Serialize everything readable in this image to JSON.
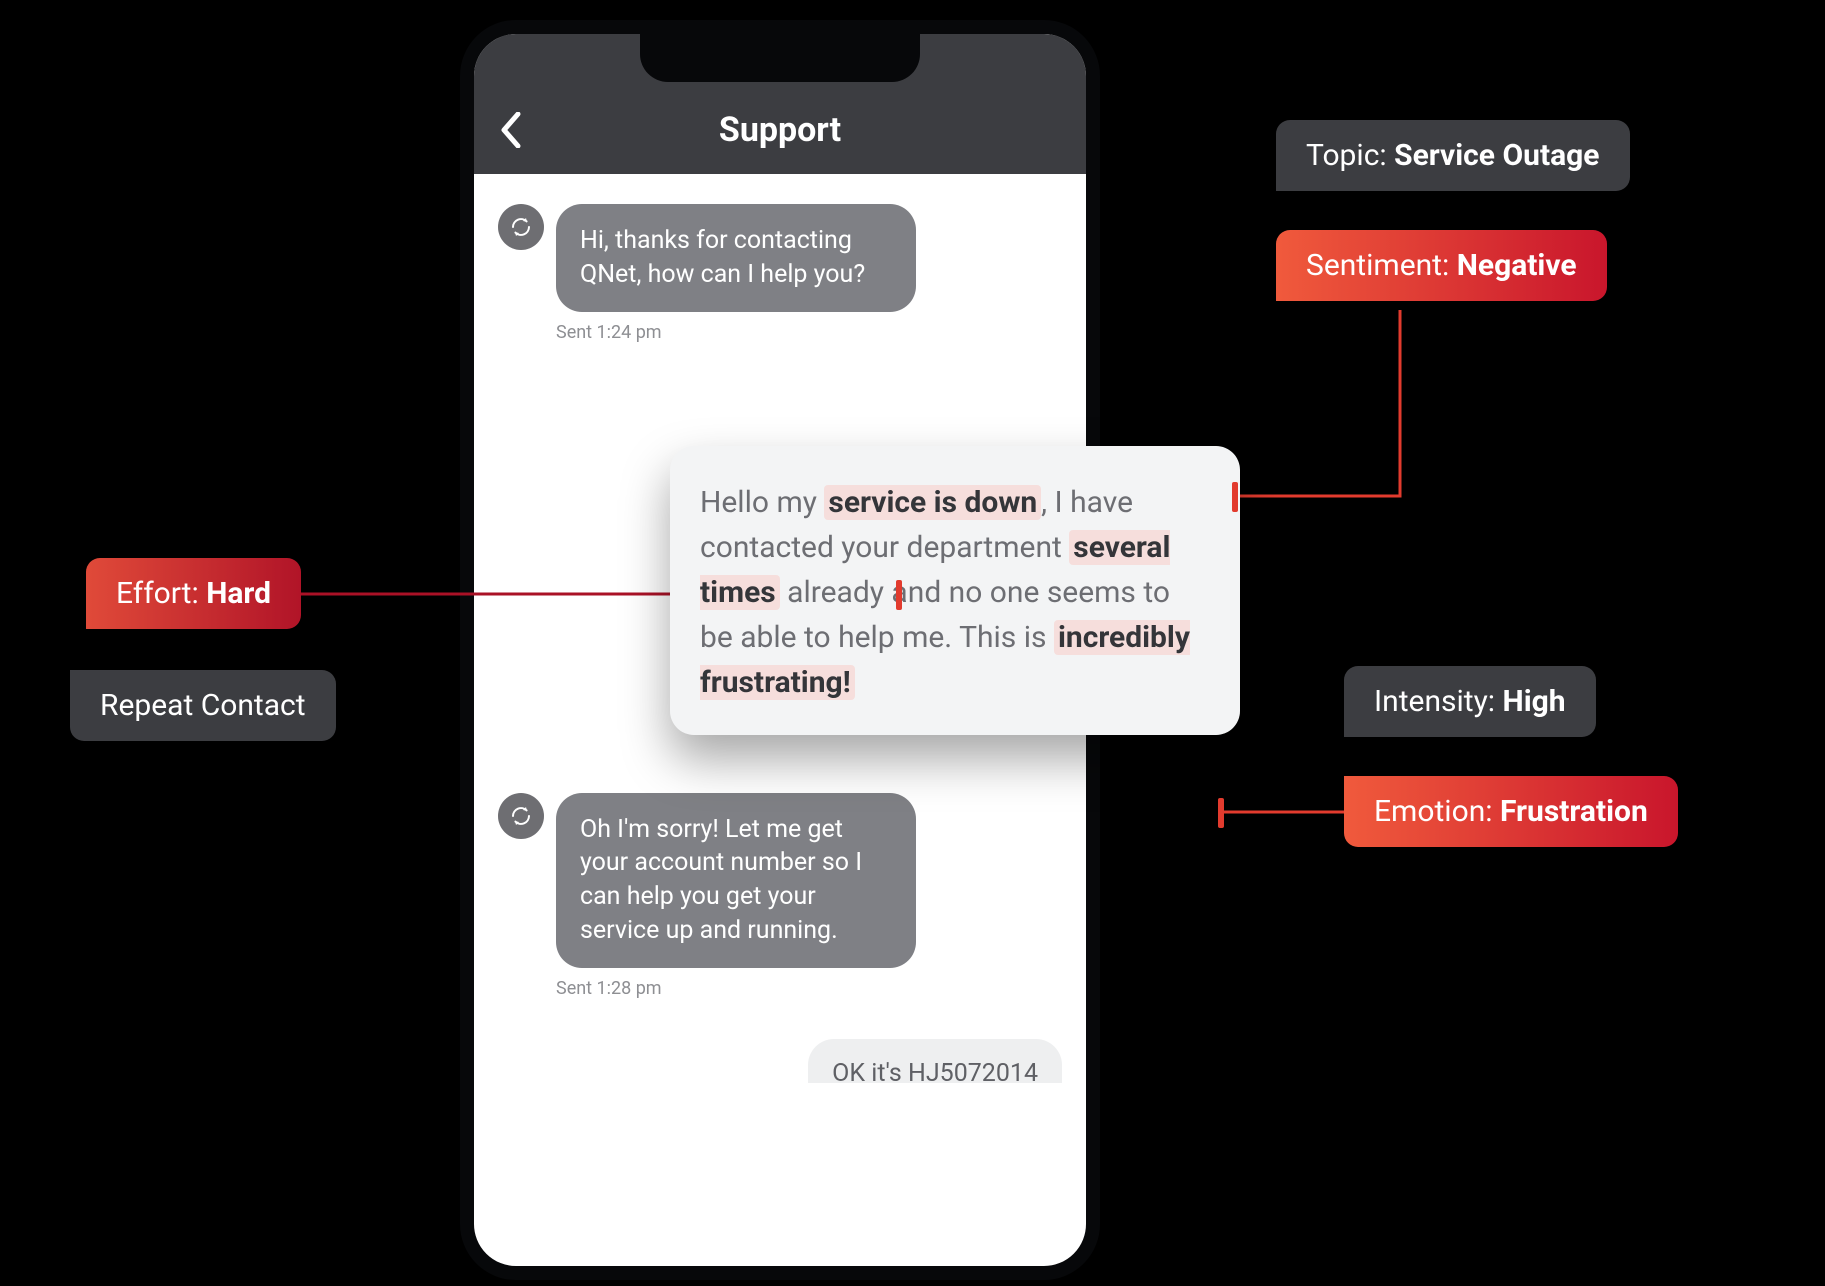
{
  "header": {
    "title": "Support"
  },
  "messages": {
    "agent1": {
      "text": "Hi, thanks for contacting QNet, how can I help you?",
      "timestamp": "Sent 1:24 pm"
    },
    "agent2": {
      "text": "Oh I'm sorry! Let me get your account number so I can help you get your service up and running.",
      "timestamp": "Sent 1:28 pm"
    },
    "userPartial": "OK it's HJ5072014"
  },
  "userCard": {
    "t1": "Hello my ",
    "h1": "service is down",
    "t2": ", I have contacted your department ",
    "h2": "several times",
    "t3": " already and no one seems to be able to help me. This is ",
    "h3": "incredibly frustrating!"
  },
  "annotations": {
    "topic": {
      "label": "Topic: ",
      "value": "Service Outage"
    },
    "sentiment": {
      "label": "Sentiment: ",
      "value": "Negative"
    },
    "effort": {
      "label": "Effort: ",
      "value": "Hard"
    },
    "repeat": {
      "label": "Repeat Contact",
      "value": ""
    },
    "intensity": {
      "label": "Intensity: ",
      "value": "High"
    },
    "emotion": {
      "label": "Emotion: ",
      "value": "Frustration"
    }
  }
}
